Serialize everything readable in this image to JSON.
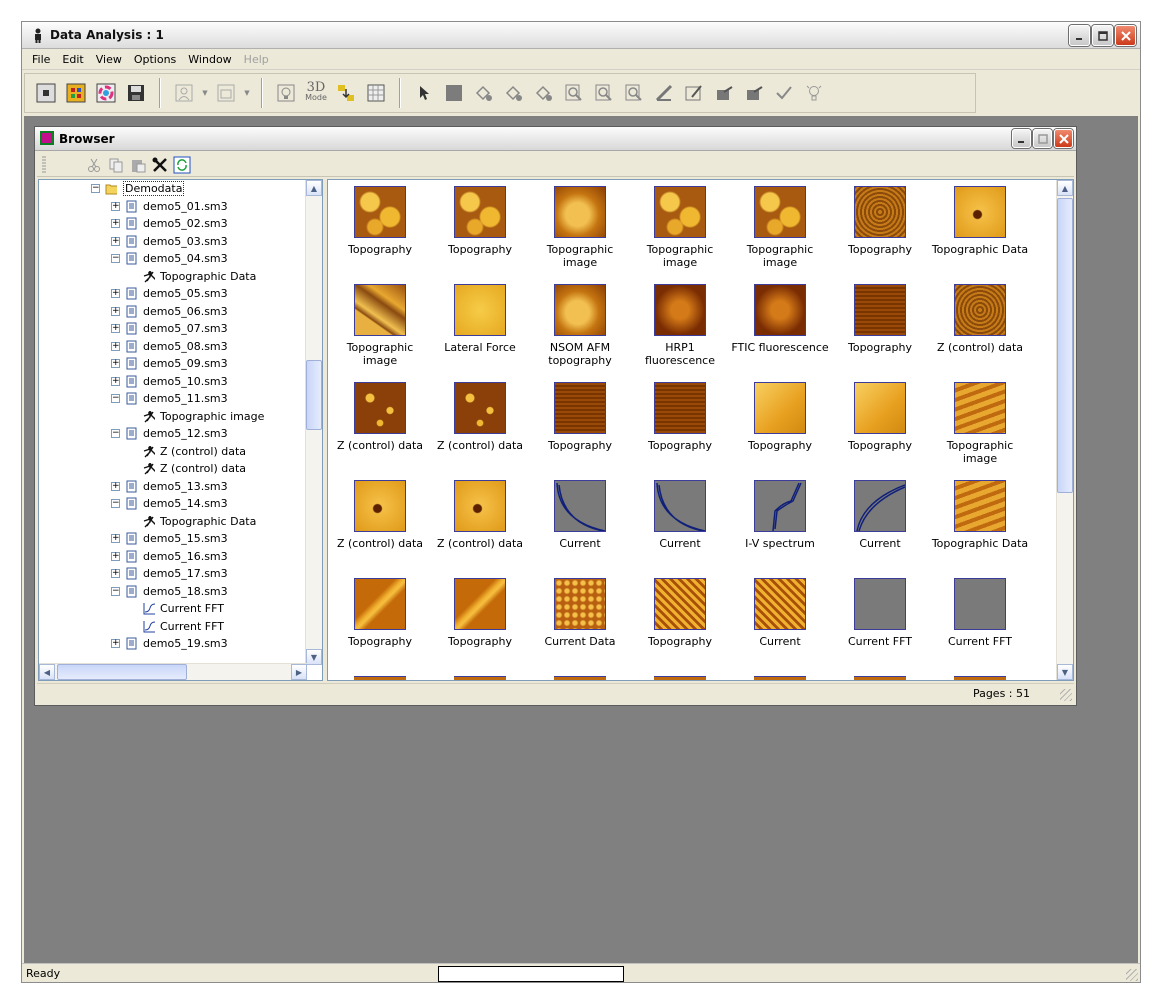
{
  "app": {
    "title": "Data Analysis : 1",
    "status": "Ready",
    "colors": {
      "accent": "#0a246a",
      "thumb_gold": "#d99a1a",
      "thumb_dark": "#8a3a00"
    }
  },
  "menu": [
    "File",
    "Edit",
    "View",
    "Options",
    "Window",
    "Help"
  ],
  "toolbar": {
    "mode_label_top": "3D",
    "mode_label_bottom": "Mode"
  },
  "browser": {
    "title": "Browser",
    "pages": "Pages : 51",
    "tree": [
      {
        "label": "Demodata",
        "type": "folder",
        "level": 0,
        "expanded": true
      },
      {
        "label": "demo5_01.sm3",
        "type": "file",
        "level": 1,
        "expanded": false
      },
      {
        "label": "demo5_02.sm3",
        "type": "file",
        "level": 1,
        "expanded": false
      },
      {
        "label": "demo5_03.sm3",
        "type": "file",
        "level": 1,
        "expanded": false
      },
      {
        "label": "demo5_04.sm3",
        "type": "file",
        "level": 1,
        "expanded": true
      },
      {
        "label": "Topographic Data",
        "type": "image",
        "level": 2
      },
      {
        "label": "demo5_05.sm3",
        "type": "file",
        "level": 1,
        "expanded": false
      },
      {
        "label": "demo5_06.sm3",
        "type": "file",
        "level": 1,
        "expanded": false
      },
      {
        "label": "demo5_07.sm3",
        "type": "file",
        "level": 1,
        "expanded": false
      },
      {
        "label": "demo5_08.sm3",
        "type": "file",
        "level": 1,
        "expanded": false
      },
      {
        "label": "demo5_09.sm3",
        "type": "file",
        "level": 1,
        "expanded": false
      },
      {
        "label": "demo5_10.sm3",
        "type": "file",
        "level": 1,
        "expanded": false
      },
      {
        "label": "demo5_11.sm3",
        "type": "file",
        "level": 1,
        "expanded": true
      },
      {
        "label": "Topographic image",
        "type": "image",
        "level": 2
      },
      {
        "label": "demo5_12.sm3",
        "type": "file",
        "level": 1,
        "expanded": true
      },
      {
        "label": "Z (control) data",
        "type": "image",
        "level": 2
      },
      {
        "label": "Z (control) data",
        "type": "image",
        "level": 2
      },
      {
        "label": "demo5_13.sm3",
        "type": "file",
        "level": 1,
        "expanded": false
      },
      {
        "label": "demo5_14.sm3",
        "type": "file",
        "level": 1,
        "expanded": true
      },
      {
        "label": "Topographic Data",
        "type": "image",
        "level": 2
      },
      {
        "label": "demo5_15.sm3",
        "type": "file",
        "level": 1,
        "expanded": false
      },
      {
        "label": "demo5_16.sm3",
        "type": "file",
        "level": 1,
        "expanded": false
      },
      {
        "label": "demo5_17.sm3",
        "type": "file",
        "level": 1,
        "expanded": false
      },
      {
        "label": "demo5_18.sm3",
        "type": "file",
        "level": 1,
        "expanded": true
      },
      {
        "label": "Current FFT",
        "type": "curve",
        "level": 2
      },
      {
        "label": "Current FFT",
        "type": "curve",
        "level": 2
      },
      {
        "label": "demo5_19.sm3",
        "type": "file",
        "level": 1,
        "expanded": false
      }
    ],
    "thumbs": [
      [
        {
          "label": "Topography",
          "kind": "grain"
        },
        {
          "label": "Topography",
          "kind": "grain"
        },
        {
          "label": "Topographic image",
          "kind": "blob"
        },
        {
          "label": "Topographic image",
          "kind": "grain"
        },
        {
          "label": "Topographic image",
          "kind": "grain"
        },
        {
          "label": "Topography",
          "kind": "fine"
        },
        {
          "label": "Topographic Data",
          "kind": "dot"
        }
      ],
      [
        {
          "label": "Topographic image",
          "kind": "flake"
        },
        {
          "label": "Lateral Force",
          "kind": "smooth"
        },
        {
          "label": "NSOM AFM topography",
          "kind": "blob"
        },
        {
          "label": "HRP1 fluorescence",
          "kind": "dark"
        },
        {
          "label": "FTIC fluorescence",
          "kind": "dark"
        },
        {
          "label": "Topography",
          "kind": "darkgrid"
        },
        {
          "label": "Z (control) data",
          "kind": "fine"
        }
      ],
      [
        {
          "label": "Z (control) data",
          "kind": "spots"
        },
        {
          "label": "Z (control) data",
          "kind": "spots"
        },
        {
          "label": "Topography",
          "kind": "darkgrid"
        },
        {
          "label": "Topography",
          "kind": "darkgrid"
        },
        {
          "label": "Topography",
          "kind": "bright"
        },
        {
          "label": "Topography",
          "kind": "bright"
        },
        {
          "label": "Topographic image",
          "kind": "stripes"
        }
      ],
      [
        {
          "label": "Z (control) data",
          "kind": "dot"
        },
        {
          "label": "Z (control) data",
          "kind": "dot"
        },
        {
          "label": "Current",
          "kind": "curve-decay"
        },
        {
          "label": "Current",
          "kind": "curve-decay"
        },
        {
          "label": "I-V spectrum",
          "kind": "curve-iv"
        },
        {
          "label": "Current",
          "kind": "curve-rise"
        },
        {
          "label": "Topographic Data",
          "kind": "stripes"
        }
      ],
      [
        {
          "label": "Topography",
          "kind": "diag"
        },
        {
          "label": "Topography",
          "kind": "diag"
        },
        {
          "label": "Current Data",
          "kind": "lattice"
        },
        {
          "label": "Topography",
          "kind": "zigzag"
        },
        {
          "label": "Current",
          "kind": "zigzag"
        },
        {
          "label": "Current FFT",
          "kind": "gray"
        },
        {
          "label": "Current FFT",
          "kind": "gray"
        }
      ]
    ]
  }
}
